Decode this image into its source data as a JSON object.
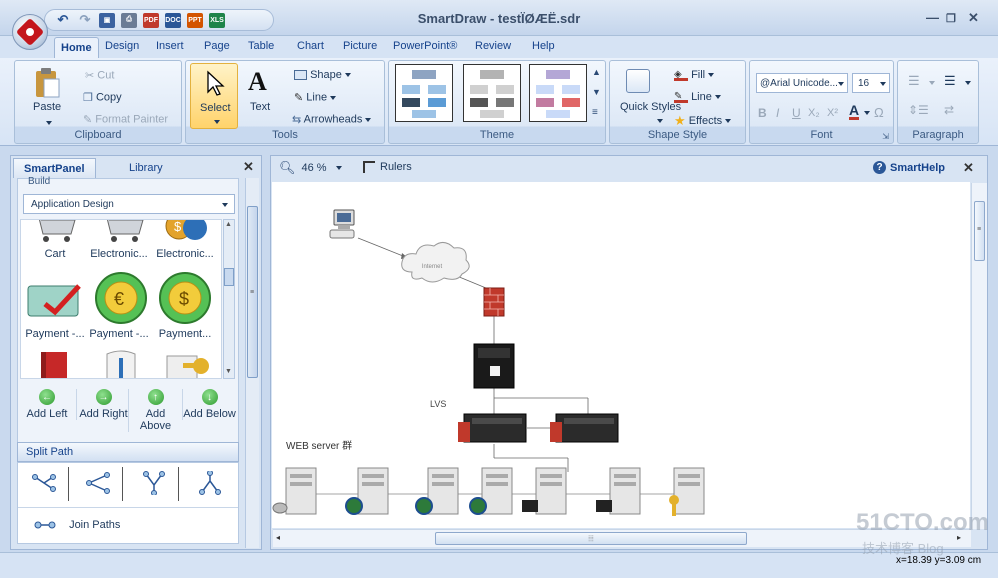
{
  "window": {
    "title": "SmartDraw - testÏØÆË.sdr"
  },
  "qat": {
    "pdf": "PDF",
    "doc": "DOC",
    "ppt": "PPT",
    "xls": "XLS"
  },
  "tabs": [
    "Home",
    "Design",
    "Insert",
    "Page",
    "Table",
    "Chart",
    "Picture",
    "PowerPoint®",
    "Review",
    "Help"
  ],
  "ribbon": {
    "clipboard": {
      "paste": "Paste",
      "cut": "Cut",
      "copy": "Copy",
      "format_painter": "Format Painter",
      "label": "Clipboard"
    },
    "tools": {
      "select": "Select",
      "text": "Text",
      "shape": "Shape",
      "line": "Line",
      "arrowheads": "Arrowheads",
      "label": "Tools"
    },
    "theme": {
      "label": "Theme"
    },
    "shape_style": {
      "quick_styles": "Quick Styles",
      "fill": "Fill",
      "line": "Line",
      "effects": "Effects",
      "label": "Shape Style"
    },
    "font": {
      "family": "@Arial Unicode...",
      "size": "16",
      "bold": "B",
      "italic": "I",
      "underline": "U",
      "subscript": "X₂",
      "superscript": "X²",
      "color": "A",
      "omega": "Ω",
      "label": "Font"
    },
    "paragraph": {
      "label": "Paragraph"
    }
  },
  "panel": {
    "tab_smart": "SmartPanel",
    "tab_library": "Library",
    "close": "✕",
    "build_label": "Build",
    "dropdown": "Application Design",
    "symbols": [
      {
        "label": "Cart"
      },
      {
        "label": "Electronic..."
      },
      {
        "label": "Electronic..."
      },
      {
        "label": "Payment -..."
      },
      {
        "label": "Payment -..."
      },
      {
        "label": "Payment..."
      }
    ],
    "add": [
      {
        "label": "Add Left",
        "glyph": "←"
      },
      {
        "label": "Add Right",
        "glyph": "→"
      },
      {
        "label": "Add Above",
        "glyph": "↑"
      },
      {
        "label": "Add Below",
        "glyph": "↓"
      }
    ],
    "split_path": "Split Path",
    "join_paths": "Join Paths"
  },
  "canvas_toolbar": {
    "zoom": "46 %",
    "rulers": "Rulers",
    "smarthelp": "SmartHelp",
    "close": "✕"
  },
  "diagram": {
    "cloud_label": "Internet",
    "lvs_label": "LVS",
    "web_label": "WEB server 群"
  },
  "status": {
    "coords": "x=18.39  y=3.09 cm"
  },
  "watermark": {
    "line1": "51CTO.com",
    "line2": "技术博客  Blog"
  },
  "colors": {
    "accent": "#15428b",
    "ribbon_bg": "#dfe9f5",
    "firewall": "#c0392b"
  }
}
